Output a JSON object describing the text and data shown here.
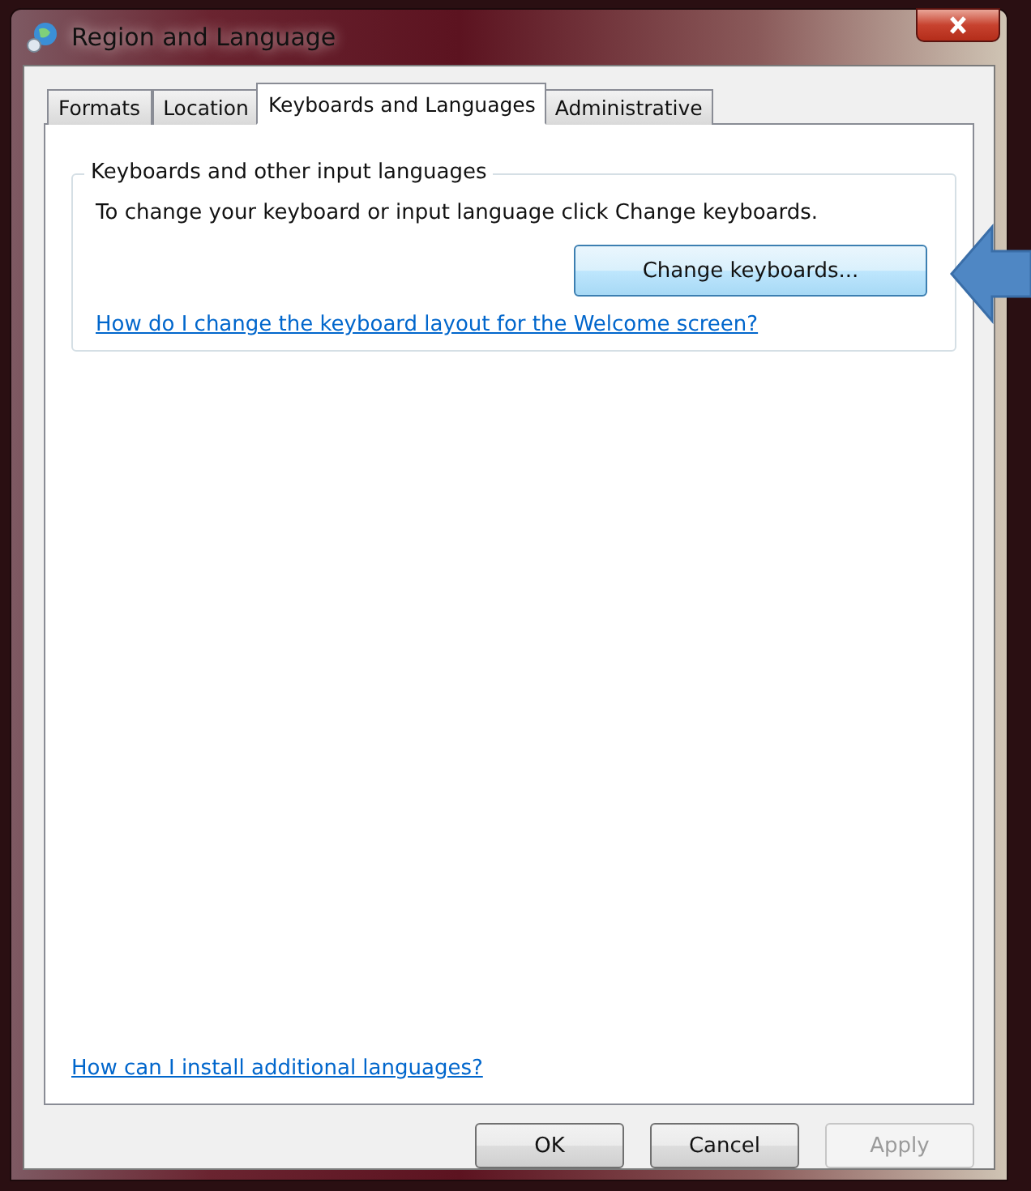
{
  "window": {
    "title": "Region and Language"
  },
  "tabs": [
    {
      "label": "Formats",
      "selected": false
    },
    {
      "label": "Location",
      "selected": false
    },
    {
      "label": "Keyboards and Languages",
      "selected": true
    },
    {
      "label": "Administrative",
      "selected": false
    }
  ],
  "group": {
    "title": "Keyboards and other input languages",
    "description": "To change your keyboard or input language click Change keyboards.",
    "button": "Change keyboards...",
    "link": "How do I change the keyboard layout for the Welcome screen?"
  },
  "bottom_link": "How can I install additional languages?",
  "buttons": [
    {
      "label": "OK",
      "disabled": false
    },
    {
      "label": "Cancel",
      "disabled": false
    },
    {
      "label": "Apply",
      "disabled": true
    }
  ]
}
